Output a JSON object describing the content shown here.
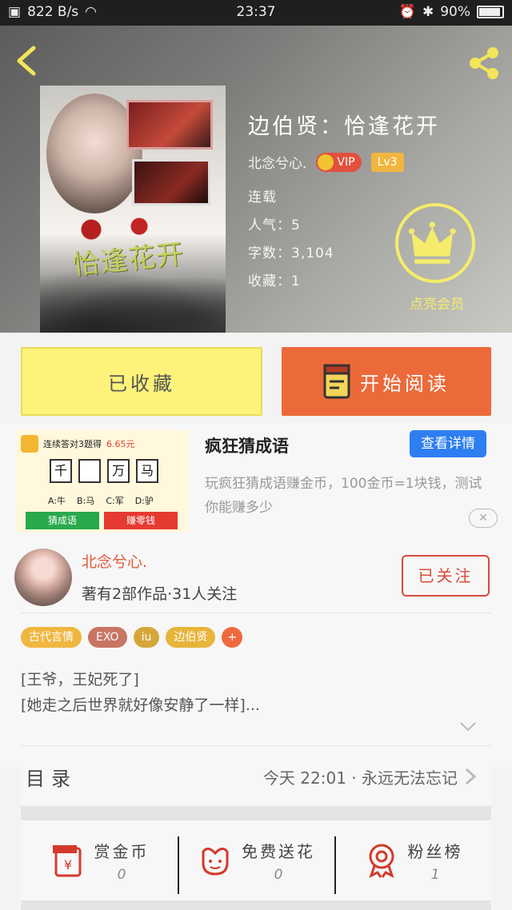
{
  "status_bar": {
    "speed": "822 B/s",
    "time": "23:37",
    "battery": "90%"
  },
  "book": {
    "title": "边伯贤：恰逢花开",
    "cover_title": "恰逢花开",
    "author": "北念兮心.",
    "vip_label": "VIP",
    "level": "Lv3",
    "status": "连载",
    "popularity": "人气：5",
    "word_count": "字数：3,104",
    "favorites": "收藏：1",
    "member_label": "点亮会员"
  },
  "actions": {
    "collected": "已收藏",
    "start_reading": "开始阅读"
  },
  "ad": {
    "title": "疯狂猜成语",
    "detail_button": "查看详情",
    "description": "玩疯狂猜成语赚金币，100金币=1块钱，测试你能赚多少",
    "close": "✕",
    "image": {
      "headline_prefix": "连续答对3题得",
      "headline_money": "6.65元",
      "chars": [
        "千",
        "",
        "万",
        "马"
      ],
      "options": [
        "A:牛",
        "B:马",
        "C:军",
        "D:驴"
      ],
      "btn_guess": "猜成语",
      "btn_earn": "赚零钱"
    }
  },
  "author_card": {
    "name": "北念兮心.",
    "stats": "著有2部作品·31人关注",
    "follow_button": "已关注"
  },
  "tags": [
    {
      "label": "古代言情",
      "color": "#f0b640"
    },
    {
      "label": "EXO",
      "color": "#c97563"
    },
    {
      "label": "iu",
      "color": "#d5a73a"
    },
    {
      "label": "边伯贤",
      "color": "#e8b43a"
    },
    {
      "label": "+",
      "color": "#ee6a3e"
    }
  ],
  "synopsis": [
    "[王爷，王妃死了]",
    "[她走之后世界就好像安静了一样]..."
  ],
  "toc": {
    "label": "目录",
    "latest": "今天 22:01 · 永远无法忘记"
  },
  "bottom_stats": [
    {
      "label": "赏金币",
      "value": "0",
      "icon": "red-envelope-icon"
    },
    {
      "label": "免费送花",
      "value": "0",
      "icon": "flower-icon"
    },
    {
      "label": "粉丝榜",
      "value": "1",
      "icon": "medal-icon"
    }
  ],
  "colors": {
    "accent": "#ec6a3a",
    "collected_bg": "#fdf37a",
    "detail_blue": "#2d7ef0",
    "icon_red": "#d33a2c"
  }
}
